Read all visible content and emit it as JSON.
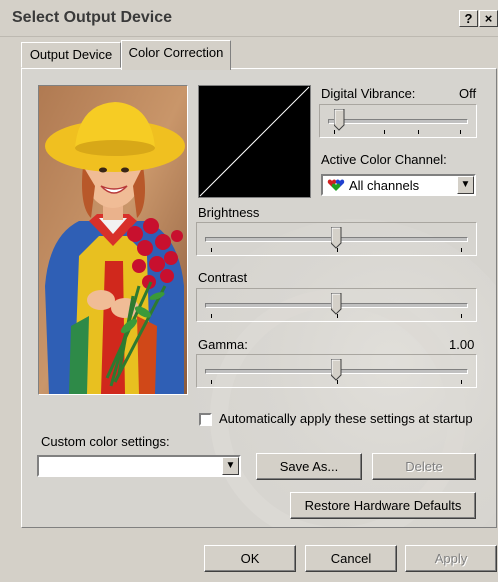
{
  "window": {
    "title": "Select Output Device",
    "help_button": "?",
    "close_button": "×"
  },
  "tabs": [
    {
      "label": "Output Device",
      "active": false
    },
    {
      "label": "Color Correction",
      "active": true
    }
  ],
  "digital_vibrance": {
    "label": "Digital Vibrance:",
    "value_text": "Off",
    "level": 0.05
  },
  "active_color_channel": {
    "label": "Active Color Channel:",
    "selected": "All channels",
    "icon": "rgb-hearts-icon"
  },
  "brightness": {
    "label": "Brightness",
    "level": 0.5
  },
  "contrast": {
    "label": "Contrast",
    "level": 0.5
  },
  "gamma": {
    "label": "Gamma:",
    "value_text": "1.00",
    "level": 0.5
  },
  "auto_apply": {
    "label": "Automatically apply these settings at startup",
    "checked": false
  },
  "custom_settings": {
    "label": "Custom color settings:",
    "value": ""
  },
  "buttons": {
    "save_as": "Save As...",
    "delete": "Delete",
    "restore": "Restore Hardware Defaults",
    "ok": "OK",
    "cancel": "Cancel",
    "apply": "Apply"
  },
  "colors": {
    "dialog_face": "#d4d0c8",
    "preview_bg": "#000000",
    "preview_line": "#ffffff"
  }
}
